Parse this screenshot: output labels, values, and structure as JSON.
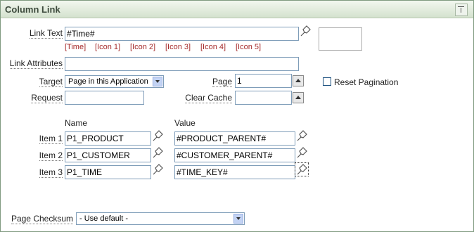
{
  "panel": {
    "title": "Column Link",
    "collapse_icon": "collapse-icon"
  },
  "fields": {
    "link_text": {
      "label": "Link Text",
      "value": "#Time#"
    },
    "substitutions": [
      "[Time]",
      "[Icon 1]",
      "[Icon 2]",
      "[Icon 3]",
      "[Icon 4]",
      "[Icon 5]"
    ],
    "link_attributes": {
      "label": "Link Attributes",
      "value": ""
    },
    "target": {
      "label": "Target",
      "value": "Page in this Application"
    },
    "page": {
      "label": "Page",
      "value": "1"
    },
    "reset_pagination": {
      "label": "Reset Pagination",
      "checked": false
    },
    "request": {
      "label": "Request",
      "value": ""
    },
    "clear_cache": {
      "label": "Clear Cache",
      "value": ""
    }
  },
  "items": {
    "name_header": "Name",
    "value_header": "Value",
    "rows": [
      {
        "label": "Item 1",
        "name": "P1_PRODUCT",
        "value": "#PRODUCT_PARENT#"
      },
      {
        "label": "Item 2",
        "name": "P1_CUSTOMER",
        "value": "#CUSTOMER_PARENT#"
      },
      {
        "label": "Item 3",
        "name": "P1_TIME",
        "value": "#TIME_KEY#"
      }
    ]
  },
  "checksum": {
    "label": "Page Checksum",
    "value": "- Use default -"
  },
  "colors": {
    "header_bg": "#d4e2ce",
    "link_red": "#a52a2a",
    "input_border": "#7f9db9"
  }
}
